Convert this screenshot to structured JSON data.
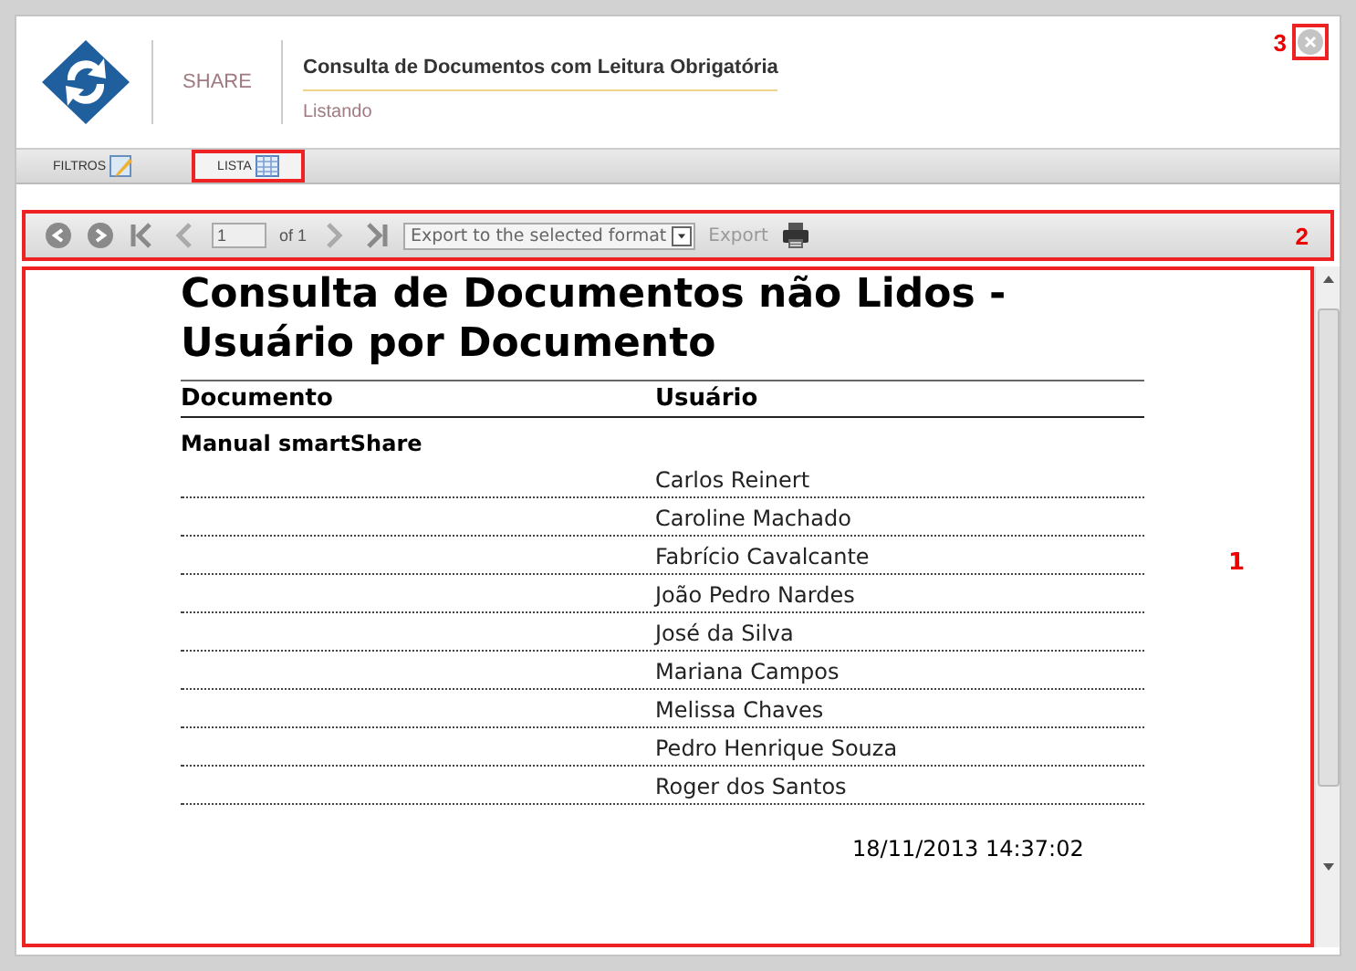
{
  "header": {
    "brand": "SHARE",
    "title": "Consulta de Documentos com Leitura Obrigatória",
    "subtitle": "Listando",
    "close_callout": "3"
  },
  "tabs": [
    {
      "label": "FILTROS",
      "selected": false,
      "highlighted": false,
      "kind": "filter"
    },
    {
      "label": "LISTA",
      "selected": true,
      "highlighted": true,
      "kind": "list"
    }
  ],
  "toolbar": {
    "callout": "2",
    "page": "1",
    "page_count": "of 1",
    "export_format": "Export to the selected format",
    "export_label": "Export"
  },
  "report": {
    "callout": "1",
    "title": "Consulta de Documentos não Lidos - Usuário por Documento",
    "columns": [
      "Documento",
      "Usuário"
    ],
    "groups": [
      {
        "document": "Manual smartShare",
        "users": [
          "Carlos Reinert",
          "Caroline Machado",
          "Fabrício Cavalcante",
          "João Pedro Nardes",
          "José da Silva",
          "Mariana Campos",
          "Melissa Chaves",
          "Pedro Henrique Souza",
          "Roger dos Santos"
        ]
      }
    ],
    "timestamp": "18/11/2013 14:37:02"
  }
}
